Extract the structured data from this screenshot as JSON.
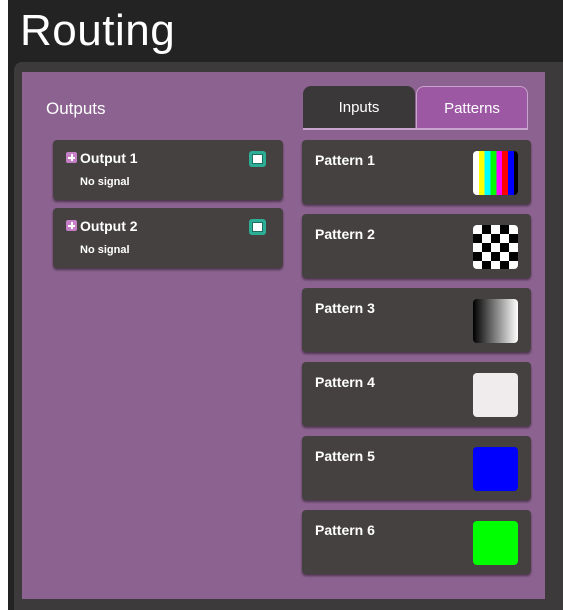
{
  "title": "Routing",
  "outputs": {
    "label": "Outputs",
    "items": [
      {
        "name": "Output 1",
        "status": "No signal"
      },
      {
        "name": "Output 2",
        "status": "No signal"
      }
    ]
  },
  "tabs": [
    {
      "label": "Inputs",
      "active": false
    },
    {
      "label": "Patterns",
      "active": true
    }
  ],
  "patterns": [
    {
      "name": "Pattern 1",
      "thumbnail": "color-bars"
    },
    {
      "name": "Pattern 2",
      "thumbnail": "checkerboard"
    },
    {
      "name": "Pattern 3",
      "thumbnail": "gradient"
    },
    {
      "name": "Pattern 4",
      "thumbnail": "solid",
      "color": "#f0ecee"
    },
    {
      "name": "Pattern 5",
      "thumbnail": "solid",
      "color": "#0000ff"
    },
    {
      "name": "Pattern 6",
      "thumbnail": "solid",
      "color": "#00ff00"
    }
  ],
  "colors": {
    "panel": "#8c6290",
    "card": "#454141",
    "active_tab": "#9d58a4",
    "monitor_icon": "#2cae96"
  }
}
